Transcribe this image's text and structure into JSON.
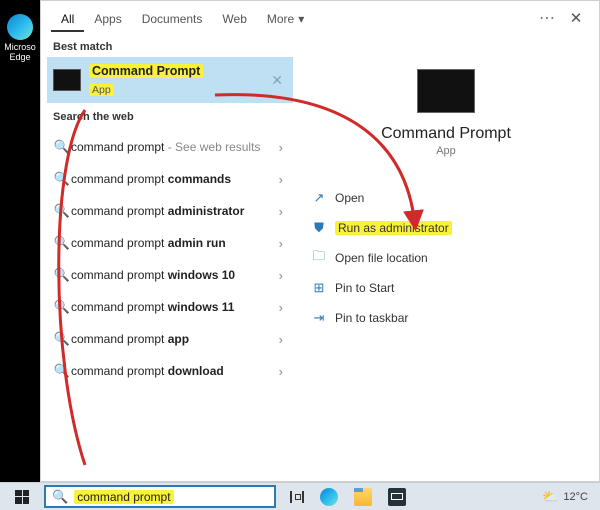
{
  "desktop": {
    "edge_label": "Microso\nEdge"
  },
  "tabs": {
    "all": "All",
    "apps": "Apps",
    "documents": "Documents",
    "web": "Web",
    "more": "More"
  },
  "left": {
    "best_match_label": "Best match",
    "best": {
      "title": "Command Prompt",
      "subtitle": "App"
    },
    "search_web_label": "Search the web",
    "web": [
      {
        "pre": "command prompt",
        "bold": "",
        "suffix": " - See web results"
      },
      {
        "pre": "command prompt ",
        "bold": "commands",
        "suffix": ""
      },
      {
        "pre": "command prompt ",
        "bold": "administrator",
        "suffix": ""
      },
      {
        "pre": "command prompt ",
        "bold": "admin run",
        "suffix": ""
      },
      {
        "pre": "command prompt ",
        "bold": "windows 10",
        "suffix": ""
      },
      {
        "pre": "command prompt ",
        "bold": "windows 11",
        "suffix": ""
      },
      {
        "pre": "command prompt ",
        "bold": "app",
        "suffix": ""
      },
      {
        "pre": "command prompt ",
        "bold": "download",
        "suffix": ""
      }
    ]
  },
  "right": {
    "title": "Command Prompt",
    "subtitle": "App",
    "actions": [
      {
        "icon": "↗",
        "label": "Open"
      },
      {
        "icon": "⛊",
        "label": "Run as administrator",
        "highlight": true
      },
      {
        "icon": "🗀",
        "label": "Open file location"
      },
      {
        "icon": "⊞",
        "label": "Pin to Start"
      },
      {
        "icon": "⇥",
        "label": "Pin to taskbar"
      }
    ]
  },
  "taskbar": {
    "search_value": "command prompt",
    "weather_temp": "12°C"
  }
}
